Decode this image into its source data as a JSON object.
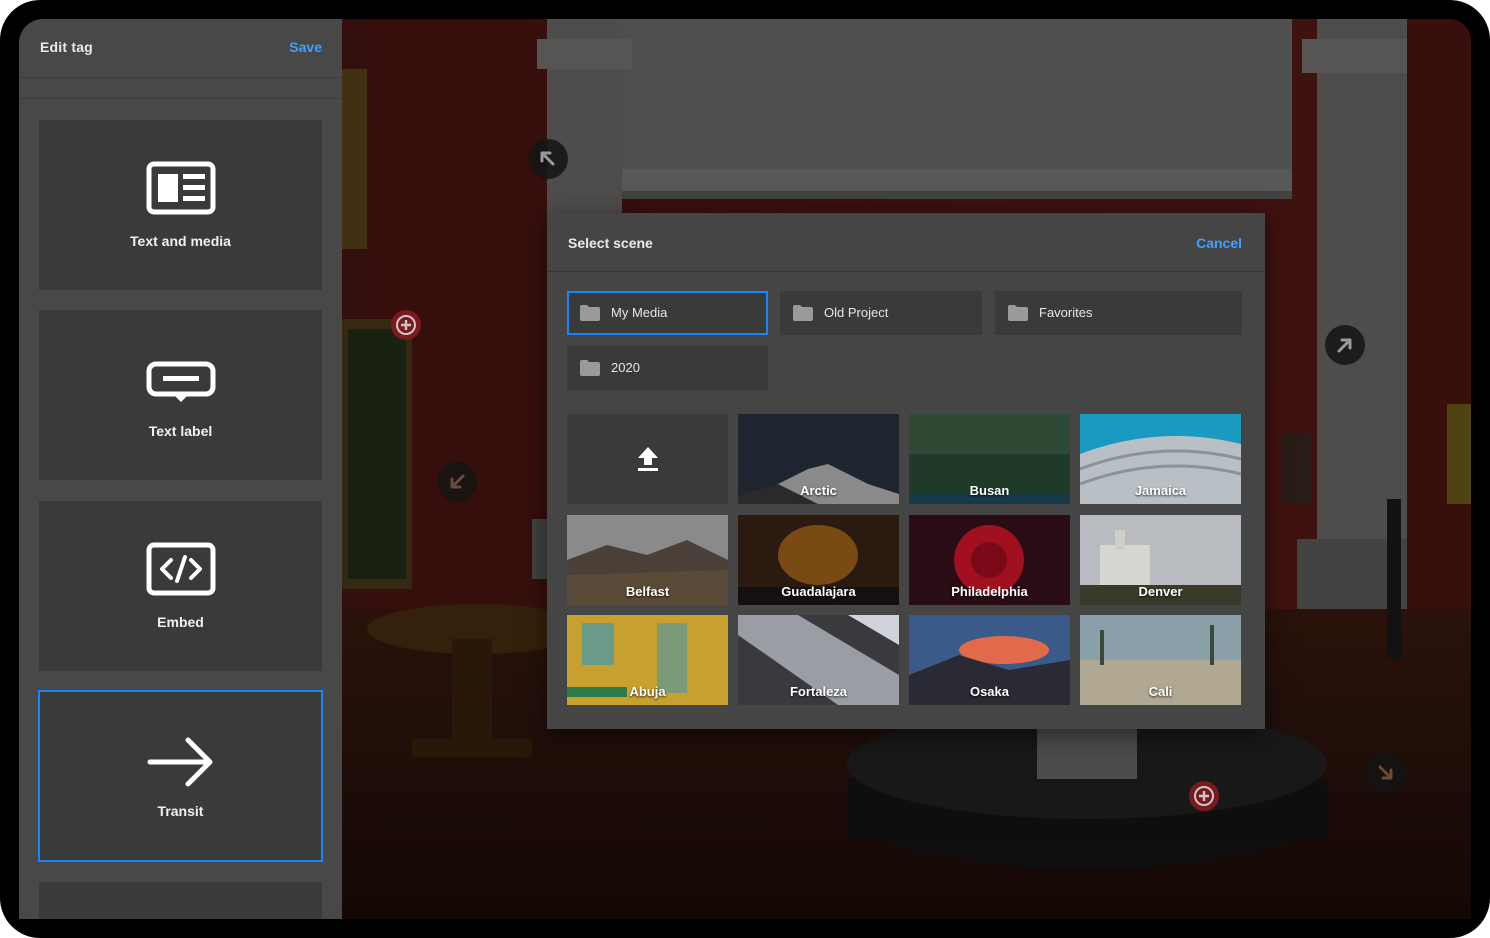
{
  "sidebar": {
    "title": "Edit tag",
    "save_label": "Save",
    "tag_types": [
      {
        "label": "Text and media",
        "icon": "text-and-media-icon"
      },
      {
        "label": "Text label",
        "icon": "text-label-icon"
      },
      {
        "label": "Embed",
        "icon": "embed-code-icon"
      },
      {
        "label": "Transit",
        "icon": "arrow-right-icon",
        "selected": true
      }
    ]
  },
  "modal": {
    "title": "Select scene",
    "cancel_label": "Cancel",
    "folders": [
      {
        "label": "My Media",
        "selected": true
      },
      {
        "label": "Old Project"
      },
      {
        "label": "Favorites"
      },
      {
        "label": "2020"
      }
    ],
    "upload_icon": "upload-icon",
    "scenes": [
      {
        "label": "Arctic"
      },
      {
        "label": "Busan"
      },
      {
        "label": "Jamaica"
      },
      {
        "label": "Belfast"
      },
      {
        "label": "Guadalajara"
      },
      {
        "label": "Philadelphia"
      },
      {
        "label": "Denver"
      },
      {
        "label": "Abuja"
      },
      {
        "label": "Fortaleza"
      },
      {
        "label": "Osaka"
      },
      {
        "label": "Cali"
      }
    ]
  },
  "colors": {
    "accent": "#1a84ff",
    "link": "#3ea0ff",
    "panel": "#484848",
    "card": "#3a3a3a",
    "add_hotspot": "#7a1a1e"
  }
}
